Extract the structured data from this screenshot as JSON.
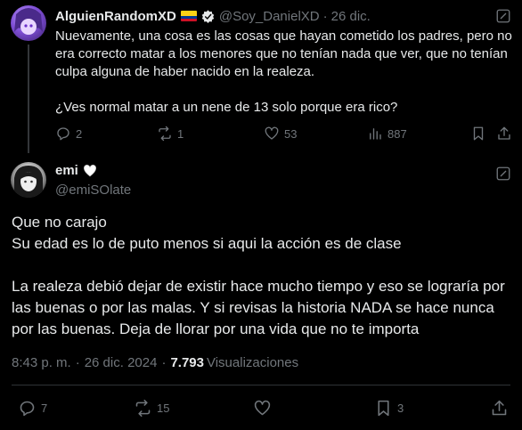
{
  "parent_tweet": {
    "display_name": "AlguienRandomXD",
    "handle": "@Soy_DanielXD",
    "separator": "·",
    "date": "26 dic.",
    "body_paragraph_1": "Nuevamente, una cosa es las cosas que hayan cometido los padres, pero no era correcto matar a los menores que no tenían nada que ver, que no tenían culpa alguna de haber nacido en la realeza.",
    "body_paragraph_2": "¿Ves normal matar a un nene de 13 solo porque era rico?",
    "replies": "2",
    "reposts": "1",
    "likes": "53",
    "views": "887",
    "flag_colors": [
      "#fcd116",
      "#003893",
      "#ce1126"
    ],
    "verified_color": "#e7e9ea"
  },
  "main_tweet": {
    "display_name": "emi",
    "name_emoji": "white-heart-icon",
    "handle": "@emiSOlate",
    "body_paragraph_1": "Que no carajo\nSu edad es lo de puto menos si aqui la acción es de clase",
    "body_paragraph_2": "La realeza debió dejar de existir hace mucho tiempo y eso se lograría por las buenas o por las malas. Y si revisas la historia NADA se hace nunca por las buenas. Deja de llorar por una vida que no te importa",
    "time": "8:43 p. m.",
    "separator": "·",
    "date": "26 dic. 2024",
    "views_count": "7.793",
    "views_label": "Visualizaciones",
    "replies": "7",
    "reposts": "15",
    "bookmarks": "3"
  },
  "colors": {
    "background": "#000000",
    "text_primary": "#e7e9ea",
    "text_secondary": "#71767b",
    "divider": "#2f3336"
  }
}
